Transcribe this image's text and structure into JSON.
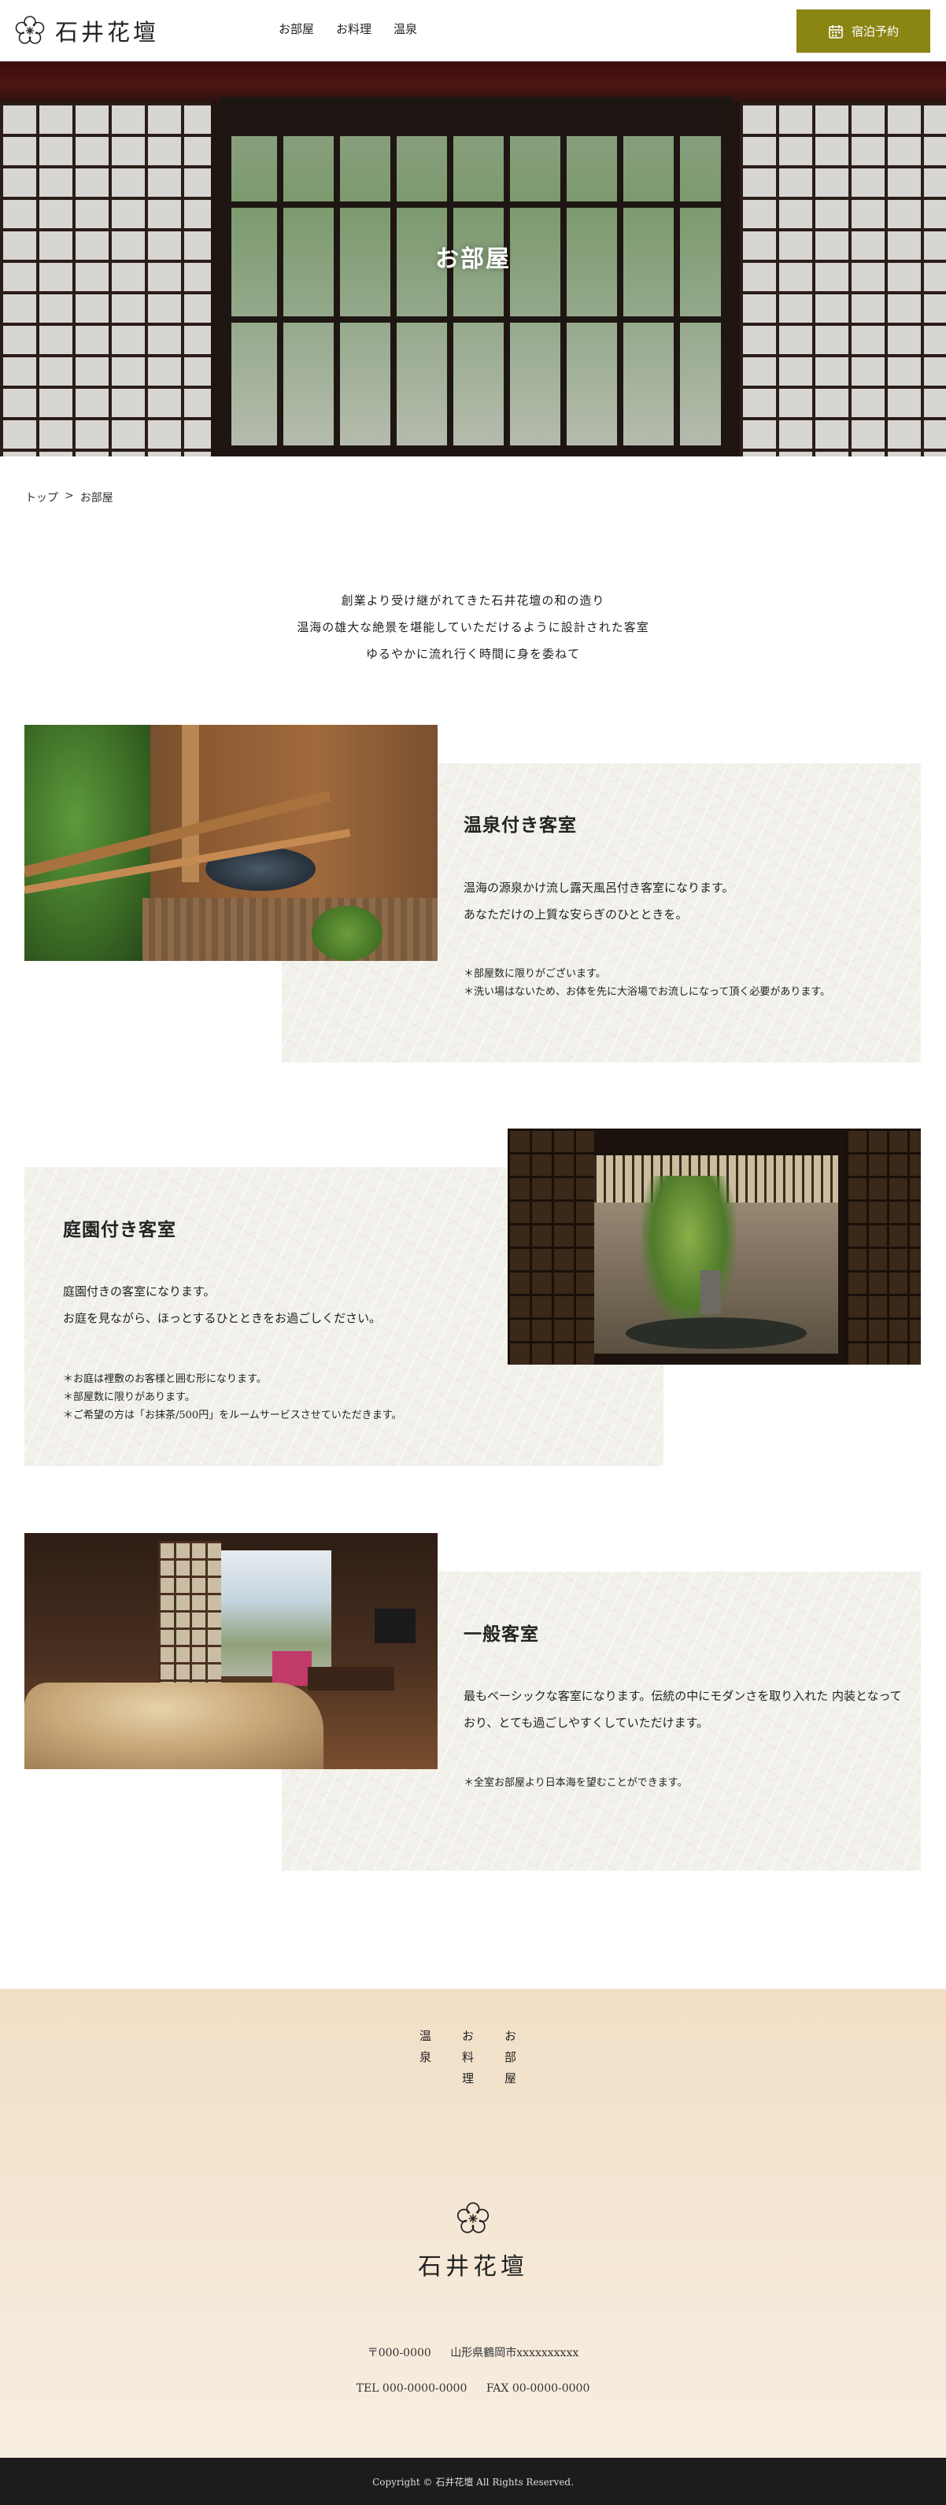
{
  "header": {
    "logo_text": "石井花壇",
    "nav": [
      "お部屋",
      "お料理",
      "温泉"
    ],
    "book_label": "宿泊予約"
  },
  "hero": {
    "title": "お部屋"
  },
  "breadcrumb": {
    "home": "トップ",
    "separator": ">",
    "current": "お部屋"
  },
  "intro": {
    "lines": [
      "創業より受け継がれてきた石井花壇の和の造り",
      "温海の雄大な絶景を堪能していただけるように設計された客室",
      "ゆるやかに流れ行く時間に身を委ねて"
    ]
  },
  "rooms": [
    {
      "title": "温泉付き客室",
      "desc": [
        "温海の源泉かけ流し露天風呂付き客室になります。",
        "あなただけの上質な安らぎのひとときを。"
      ],
      "notes": [
        "＊部屋数に限りがございます。",
        "＊洗い場はないため、お体を先に大浴場でお流しになって頂く必要があります。"
      ]
    },
    {
      "title": "庭園付き客室",
      "desc": [
        "庭園付きの客室になります。",
        "お庭を見ながら、ほっとするひとときをお過ごしください。"
      ],
      "notes": [
        "＊お庭は裡敷のお客様と囲む形になります。",
        "＊部屋数に限りがあります。",
        "＊ご希望の方は「お抹茶/500円」をルームサービスさせていただきます。"
      ]
    },
    {
      "title": "一般客室",
      "desc": [
        "最もベーシックな客室になります。伝統の中にモダンさを取り入れた 内装となって",
        "おり、とても過ごしやすくしていただけます。"
      ],
      "notes": [
        "＊全室お部屋より日本海を望むことができます。"
      ]
    }
  ],
  "footer": {
    "nav": [
      "温泉",
      "お料理",
      "お部屋"
    ],
    "logo_text": "石井花壇",
    "postal": "〒000-0000",
    "address": "山形県鶴岡市xxxxxxxxxx",
    "tel": "TEL 000-0000-0000",
    "fax": "FAX 00-0000-0000",
    "copyright": "Copyright © 石井花壇 All Rights Reserved."
  },
  "colors": {
    "accent": "#8b8513",
    "footer_bg": "#f3e3cc",
    "copy_bar": "#1c1c1c"
  },
  "icons": {
    "logo": "plum-blossom-icon",
    "booking": "calendar-icon"
  }
}
